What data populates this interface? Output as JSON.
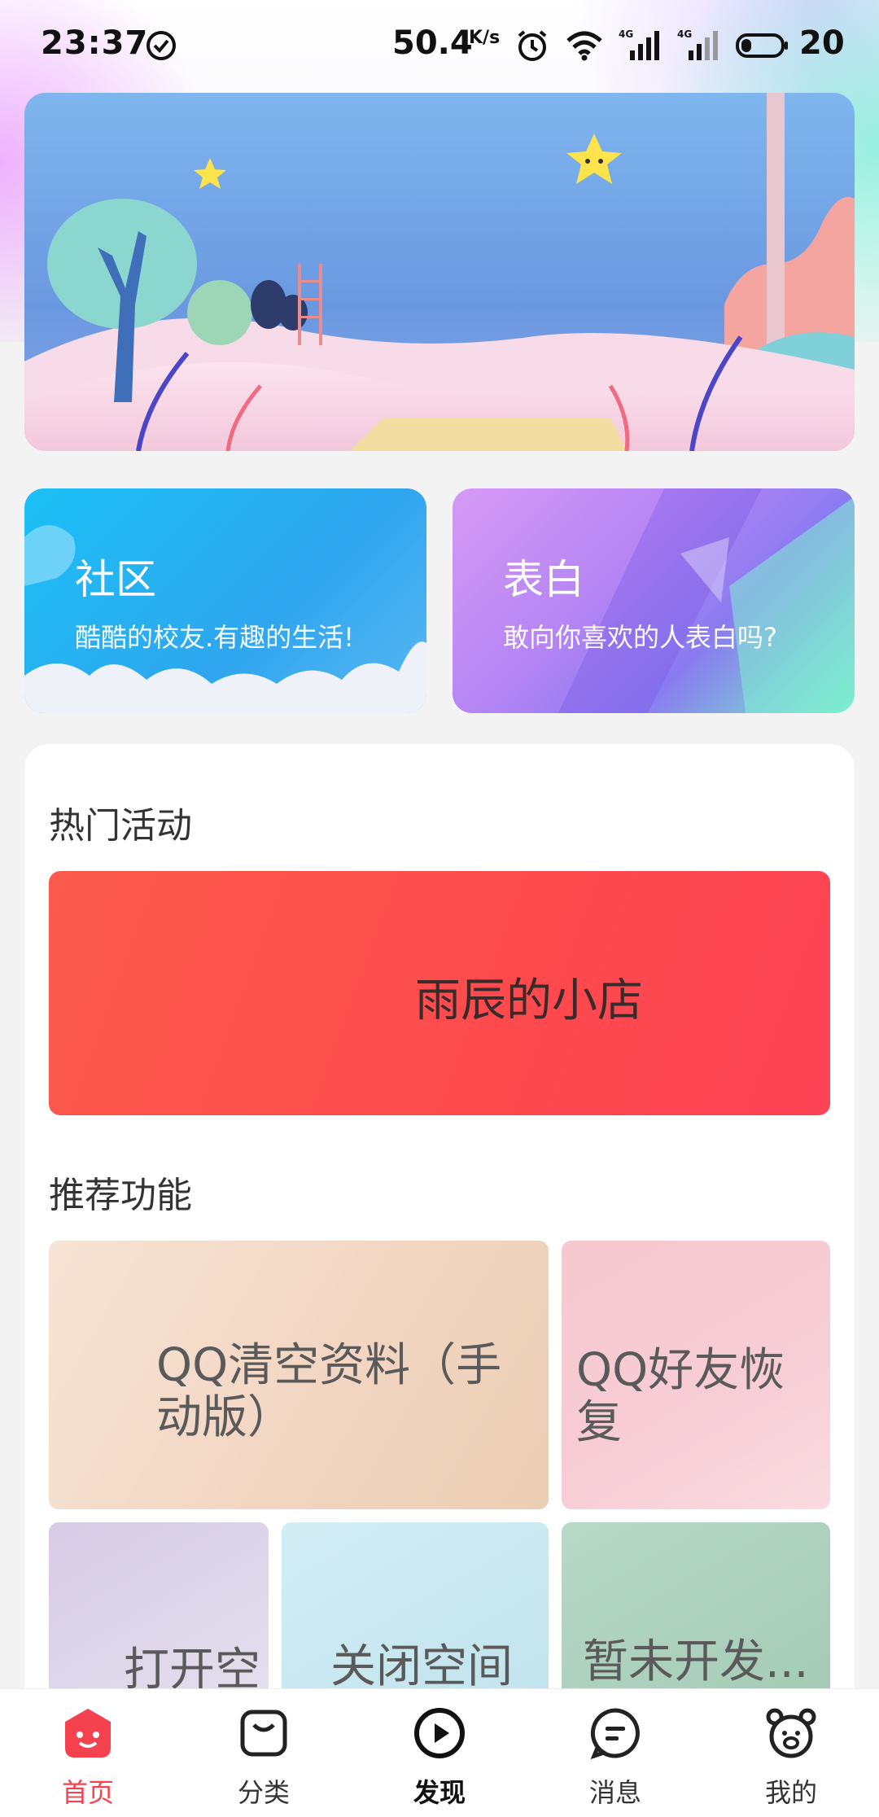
{
  "status_bar": {
    "time": "23:37",
    "net_speed": "50.4",
    "net_unit": "K/s",
    "battery": "20",
    "icons": [
      "check-circle-icon",
      "alarm-icon",
      "wifi-icon",
      "signal-4g-icon",
      "signal-4g-icon",
      "battery-icon"
    ]
  },
  "banner": {
    "image": "night-landscape-illustration"
  },
  "categories": [
    {
      "title": "社区",
      "subtitle": "酷酷的校友.有趣的生活!"
    },
    {
      "title": "表白",
      "subtitle": "敢向你喜欢的人表白吗?"
    }
  ],
  "hot": {
    "title": "热门活动",
    "card_label": "雨辰的小店"
  },
  "recommend": {
    "title": "推荐功能",
    "items": [
      {
        "label": "QQ清空资料（手动版）"
      },
      {
        "label": "QQ好友恢复"
      },
      {
        "label": "打开空"
      },
      {
        "label": "关闭空间"
      },
      {
        "label": "暂未开发..."
      }
    ]
  },
  "nav": {
    "active": "首页",
    "active_color": "#f4424f",
    "items": [
      {
        "label": "首页",
        "icon": "home-face-icon"
      },
      {
        "label": "分类",
        "icon": "bag-icon"
      },
      {
        "label": "发现",
        "icon": "play-circle-icon"
      },
      {
        "label": "消息",
        "icon": "message-icon"
      },
      {
        "label": "我的",
        "icon": "bear-face-icon"
      }
    ]
  }
}
